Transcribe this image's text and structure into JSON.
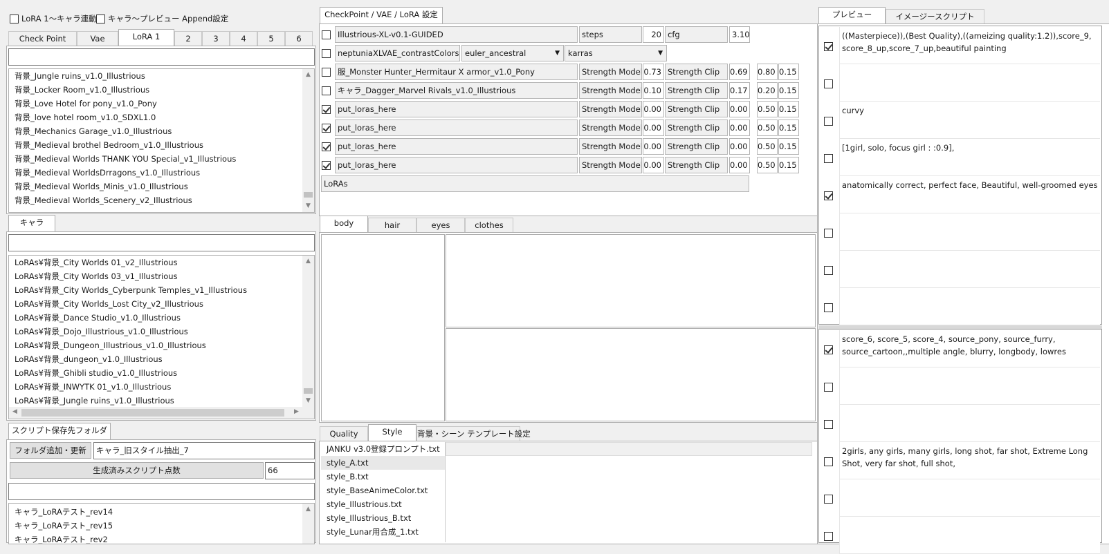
{
  "header": {
    "cb1_label": "LoRA 1〜キャラ連動",
    "cb2_label": "キャラ〜プレビュー Append設定"
  },
  "top_left": {
    "tabs": [
      "Check Point",
      "Vae",
      "LoRA 1",
      "2",
      "3",
      "4",
      "5",
      "6"
    ],
    "search_value": "",
    "items": [
      "背景_Jungle ruins_v1.0_Illustrious",
      "背景_Locker Room_v1.0_Illustrious",
      "背景_Love Hotel for pony_v1.0_Pony",
      "背景_love hotel room_v1.0_SDXL1.0",
      "背景_Mechanics Garage_v1.0_Illustrious",
      "背景_Medieval brothel Bedroom_v1.0_Illustrious",
      "背景_Medieval Worlds THANK YOU Special_v1_Illustrious",
      "背景_Medieval WorldsDrragons_v1.0_Illustrious",
      "背景_Medieval Worlds_Minis_v1.0_Illustrious",
      "背景_Medieval Worlds_Scenery_v2_Illustrious"
    ]
  },
  "chara": {
    "tab": "キャラ",
    "search_value": "",
    "items": [
      "LoRAs¥背景_City Worlds 01_v2_Illustrious",
      "LoRAs¥背景_City Worlds 03_v1_Illustrious",
      "LoRAs¥背景_City Worlds_Cyberpunk Temples_v1_Illustrious",
      "LoRAs¥背景_City Worlds_Lost City_v2_Illustrious",
      "LoRAs¥背景_Dance Studio_v1.0_Illustrious",
      "LoRAs¥背景_Dojo_Illustrious_v1.0_Illustrious",
      "LoRAs¥背景_Dungeon_Illustrious_v1.0_Illustrious",
      "LoRAs¥背景_dungeon_v1.0_Illustrious",
      "LoRAs¥背景_Ghibli studio_v1.0_Illustrious",
      "LoRAs¥背景_INWYTK 01_v1.0_Illustrious",
      "LoRAs¥背景_Jungle ruins_v1.0_Illustrious"
    ]
  },
  "script_folder": {
    "tab": "スクリプト保存先フォルダ",
    "add_button": "フォルダ追加・更新",
    "folder_value": "キャラ_旧スタイル抽出_7",
    "count_button": "生成済みスクリプト点数",
    "count_value": "66",
    "path_value": "",
    "items": [
      "キャラ_LoRAテスト_rev14",
      "キャラ_LoRAテスト_rev15",
      "キャラ_LoRAテスト_rev2"
    ]
  },
  "settings": {
    "tab": "CheckPoint / VAE / LoRA 設定",
    "checkpoint": "Illustrious-XL-v0.1-GUIDED",
    "steps_label": "steps",
    "steps_value": "20",
    "cfg_label": "cfg",
    "cfg_value": "3.10",
    "vae": "neptuniaXLVAE_contrastColors",
    "sampler": "euler_ancestral",
    "scheduler": "karras",
    "strength_model_label": "Strength Model",
    "strength_clip_label": "Strength Clip",
    "loras": [
      {
        "checked": false,
        "name": "服_Monster Hunter_Hermitaur X armor_v1.0_Pony",
        "sm": "0.73",
        "sc": "0.69",
        "a": "0.80",
        "b": "0.15"
      },
      {
        "checked": false,
        "name": "キャラ_Dagger_Marvel Rivals_v1.0_Illustrious",
        "sm": "0.10",
        "sc": "0.17",
        "a": "0.20",
        "b": "0.15"
      },
      {
        "checked": true,
        "name": "put_loras_here",
        "sm": "0.00",
        "sc": "0.00",
        "a": "0.50",
        "b": "0.15"
      },
      {
        "checked": true,
        "name": "put_loras_here",
        "sm": "0.00",
        "sc": "0.00",
        "a": "0.50",
        "b": "0.15"
      },
      {
        "checked": true,
        "name": "put_loras_here",
        "sm": "0.00",
        "sc": "0.00",
        "a": "0.50",
        "b": "0.15"
      },
      {
        "checked": true,
        "name": "put_loras_here",
        "sm": "0.00",
        "sc": "0.00",
        "a": "0.50",
        "b": "0.15"
      }
    ],
    "loras_path": "LoRAs"
  },
  "body_tabs": [
    "body",
    "hair",
    "eyes",
    "clothes"
  ],
  "bottom_tabs": [
    "Quality",
    "Style",
    "背景・シーン テンプレート設定"
  ],
  "style_files": [
    "JANKU v3.0登録プロンプト.txt",
    "style_A.txt",
    "style_B.txt",
    "style_BaseAnimeColor.txt",
    "style_Illustrious.txt",
    "style_Illustrious_B.txt",
    "style_Lunar用合成_1.txt"
  ],
  "preview": {
    "tabs": [
      "プレビュー",
      "イメージースクリプト"
    ],
    "positive": [
      {
        "checked": true,
        "text": "((Masterpiece)),(Best Quality),((ameizing quality:1.2)),score_9, score_8_up,score_7_up,beautiful painting"
      },
      {
        "checked": false,
        "text": ""
      },
      {
        "checked": false,
        "text": "curvy"
      },
      {
        "checked": false,
        "text": "[1girl, solo, focus girl : :0.9],"
      },
      {
        "checked": true,
        "text": "anatomically correct, perfect face, Beautiful, well-groomed eyes"
      },
      {
        "checked": false,
        "text": ""
      },
      {
        "checked": false,
        "text": ""
      },
      {
        "checked": false,
        "text": ""
      }
    ],
    "negative": [
      {
        "checked": true,
        "text": "score_6, score_5, score_4, source_pony, source_furry, source_cartoon,,multiple angle, blurry, longbody, lowres"
      },
      {
        "checked": false,
        "text": ""
      },
      {
        "checked": false,
        "text": ""
      },
      {
        "checked": false,
        "text": "2girls, any girls, many girls, long shot, far shot, Extreme Long Shot, very far shot, full shot,"
      },
      {
        "checked": false,
        "text": ""
      },
      {
        "checked": false,
        "text": ""
      }
    ]
  }
}
